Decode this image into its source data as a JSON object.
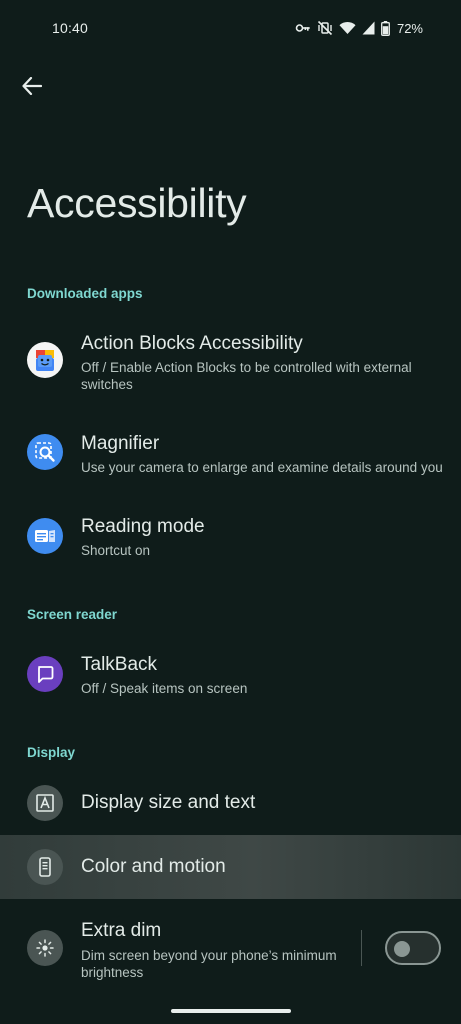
{
  "status_bar": {
    "time": "10:40",
    "battery_percent": "72%",
    "icons": [
      "vpn-key-icon",
      "vibrate-off-icon",
      "wifi-icon",
      "cell-signal-icon",
      "battery-icon"
    ]
  },
  "header": {
    "back_icon": "arrow-left-icon",
    "title": "Accessibility"
  },
  "sections": {
    "downloaded_apps": {
      "header": "Downloaded apps",
      "items": [
        {
          "title": "Action Blocks Accessibility",
          "subtitle": "Off / Enable Action Blocks to be controlled with external switches",
          "icon": "action-blocks-icon"
        },
        {
          "title": "Magnifier",
          "subtitle": "Use your camera to enlarge and examine details around you",
          "icon": "magnifier-icon"
        },
        {
          "title": "Reading mode",
          "subtitle": "Shortcut on",
          "icon": "reading-mode-icon"
        }
      ]
    },
    "screen_reader": {
      "header": "Screen reader",
      "items": [
        {
          "title": "TalkBack",
          "subtitle": "Off / Speak items on screen",
          "icon": "talkback-icon"
        }
      ]
    },
    "display": {
      "header": "Display",
      "items": [
        {
          "title": "Display size and text",
          "icon": "text-size-icon"
        },
        {
          "title": "Color and motion",
          "icon": "color-motion-icon"
        },
        {
          "title": "Extra dim",
          "subtitle": "Dim screen beyond your phone’s minimum brightness",
          "icon": "extra-dim-icon",
          "toggle_on": false
        }
      ]
    }
  },
  "colors": {
    "background": "#0f1c1a",
    "section_header": "#7fd7d0",
    "magnifier_blue": "#3f8cf0",
    "talkback_purple": "#6a3fbf"
  }
}
